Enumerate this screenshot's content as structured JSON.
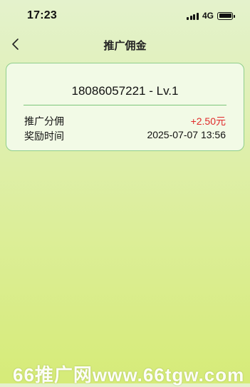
{
  "status_bar": {
    "time": "17:23",
    "network": "4G",
    "icons": [
      "signal-icon",
      "battery-icon"
    ]
  },
  "nav": {
    "title": "推广佣金",
    "back_icon": "chevron-left-icon"
  },
  "record": {
    "title": "18086057221 - Lv.1",
    "rows": [
      {
        "label": "推广分佣",
        "value": "+2.50元"
      },
      {
        "label": "奖励时间",
        "value": "2025-07-07 13:56"
      }
    ],
    "amount_color": "#e02a2a"
  },
  "watermark": {
    "text": "66推广网www.66tgw.com"
  },
  "colors": {
    "card_border": "#8fce8c",
    "divider": "#7cc57a",
    "background_top": "#e4f2cc",
    "background_bottom": "#d6eb78"
  }
}
